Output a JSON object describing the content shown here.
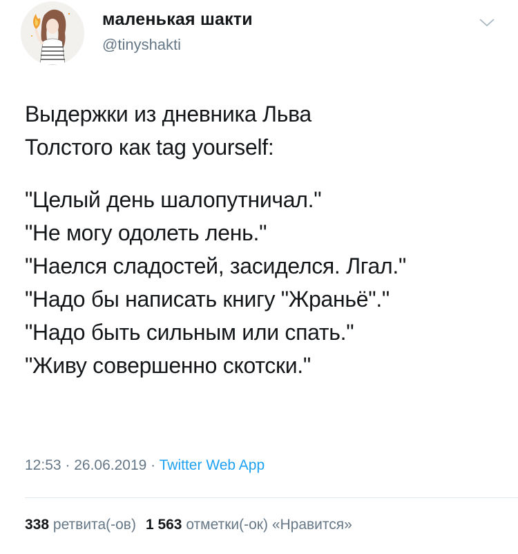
{
  "user": {
    "display_name": "маленькая шакти",
    "handle": "@tinyshakti"
  },
  "tweet": {
    "intro_lines": [
      "Выдержки из дневника Льва",
      "Толстого как tag yourself:"
    ],
    "quote_lines": [
      "\"Целый день шалопутничал.\"",
      "\"Не могу одолеть лень.\"",
      "\"Наелся сладостей, засиделся. Лгал.\"",
      "\"Надо бы написать книгу \"Жраньё\".\"",
      "\"Надо быть сильным или спать.\"",
      "\"Живу совершенно скотски.\""
    ]
  },
  "meta": {
    "time": "12:53",
    "dot1": " · ",
    "date": "26.06.2019",
    "dot2": " · ",
    "source": "Twitter Web App"
  },
  "stats": {
    "retweets_count": "338",
    "retweets_label": "ретвита(-ов)",
    "likes_count": "1 563",
    "likes_label": "отметки(-ок) «Нравится»"
  },
  "icons": {
    "caret": "chevron-down-icon",
    "avatar": "avatar-illustration"
  },
  "colors": {
    "text": "#14171a",
    "secondary": "#657786",
    "link": "#1da1f2",
    "divider": "#e1e8ed"
  }
}
